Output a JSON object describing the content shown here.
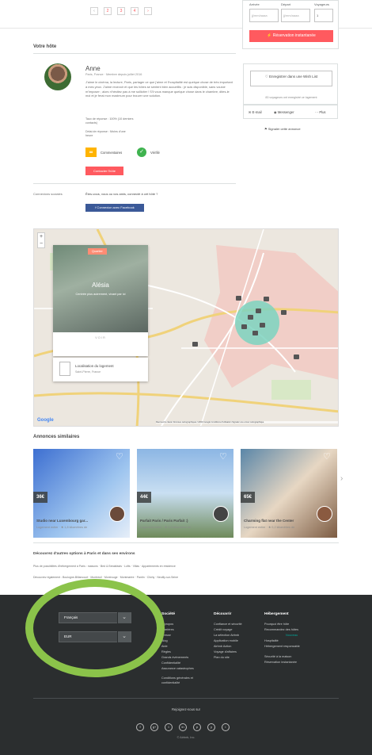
{
  "pagination": {
    "prev": "‹",
    "pages": [
      "2",
      "3",
      "4"
    ],
    "next": "›"
  },
  "booking": {
    "checkin_label": "Arrivée",
    "checkout_label": "Départ",
    "guests_label": "Voyageurs",
    "checkin_placeholder": "jj/mm/aaaa",
    "checkout_placeholder": "jj/mm/aaaa",
    "guests_value": "1",
    "cta": "⚡ Réservation instantanée"
  },
  "host": {
    "section_title": "Votre hôte",
    "name": "Anne",
    "meta": "Paris, France · Membre depuis juillet 2016",
    "bio": "J'aime le cinéma, la lecture, Paris, partager ce que j'aime et l'hospitalité est quelque chose de très important à mes yeux. J'aime recevoir et que les hôtes se sentent bien accueillis : je suis disponible, sans vouloir m'imposer ; alors n'hésitez pas à me solliciter ! S'il vous manque quelque chose dans le chambre, dites-le moi et je ferai mon maximum pour trouver une solution.",
    "response_rate": "Taux de réponse : 100% (10 derniers contacts)",
    "response_time": "Délai de réponse : Moins d'une heure",
    "reviews_count": "88",
    "reviews_label": "Commentaires",
    "verified_label": "Vérifié",
    "contact_button": "Contacter l'hôte"
  },
  "wishlist": {
    "button": "♡ Enregistrer dans une Wish List",
    "saved_note": "83 voyageurs ont enregistré ce logement",
    "email": "✉ E-mail",
    "messenger": "◉ Messenger",
    "more": "··· Plus",
    "report": "⚑ Signaler cette annonce"
  },
  "connections": {
    "label": "Connexions sociales",
    "text": "Êtes-vous, vous ou vos amis, connecté à cet hôte ?",
    "fb_button": "f  Connexion avec Facebook"
  },
  "map": {
    "tag": "Quartier",
    "neighborhood": "Alésia",
    "blurb": "Centrée plus autrement, vivant par ici",
    "more": "VOIR",
    "location_title": "Localisation du logement",
    "location_sub": "Saint-Pierre, France",
    "zoom_in": "+",
    "zoom_out": "−",
    "google": "Google",
    "attribution": "Raccourcis clavier  Données cartographiques ©2019 Google  Conditions d'utilisation  Signaler une erreur cartographique",
    "colors": {
      "water": "#a3ccff",
      "zone": "#f2c8c1",
      "circle": "#7dd3c0"
    }
  },
  "similar": {
    "title": "Annonces similaires",
    "listings": [
      {
        "price": "36€",
        "title": "Studio near Luxembourg gar...",
        "sub": "Logement entier · ★ 1,8 kilomètres de"
      },
      {
        "price": "44€",
        "title": "Parfait Paris / Paris Parfait :)",
        "sub": "Logement entier · ★ 3,8 kilomètres de"
      },
      {
        "price": "65€",
        "title": "Charming flat near the Center",
        "sub": "Logement entier · ★ 0,2 kilomètres de"
      }
    ]
  },
  "discover": {
    "title": "Découvrez d'autres options à Paris et dans ses environs",
    "line1": "Plus de possibilités d'hébergement à Paris : maisons · Bed & Breakfasts · Lofts · Villas · Appartements en résidence",
    "line2": "Découvrez également : Boulogne-Billancourt · Montreuil · Montrouge · Montmartre · Pantin · Clichy · Neuilly-sur-Seine"
  },
  "footer": {
    "language": "Français",
    "currency": "EUR",
    "col1_title": "Société",
    "col1": [
      "À propos",
      "Carrières",
      "Presse",
      "Blog",
      "Aide",
      "Règles",
      "Grands événements",
      "Confidentialité",
      "Assurance catastrophes",
      "Conditions générales et confidentialité"
    ],
    "col2_title": "Découvrir",
    "col2": [
      "Confiance et sécurité",
      "Crédit voyage",
      "La sélection Airbnb",
      "Application mobile",
      "Airbnb Action",
      "Voyage d'affaires",
      "Plan du site"
    ],
    "col3_title": "Hébergement",
    "col3": [
      "Pourquoi être hôte",
      "Recommandez des hôtes",
      "Hospitalité",
      "Hébergement responsable",
      "Sécurité à la maison",
      "Réservation instantanée"
    ],
    "new_badge": "Nouveau",
    "join": "Rejoignez-nous sur",
    "social": [
      "f",
      "g+",
      "t",
      "in",
      "p",
      "y",
      "i"
    ],
    "copyright": "© Airbnb, Inc.",
    "highlight_color": "#8bc34a"
  }
}
